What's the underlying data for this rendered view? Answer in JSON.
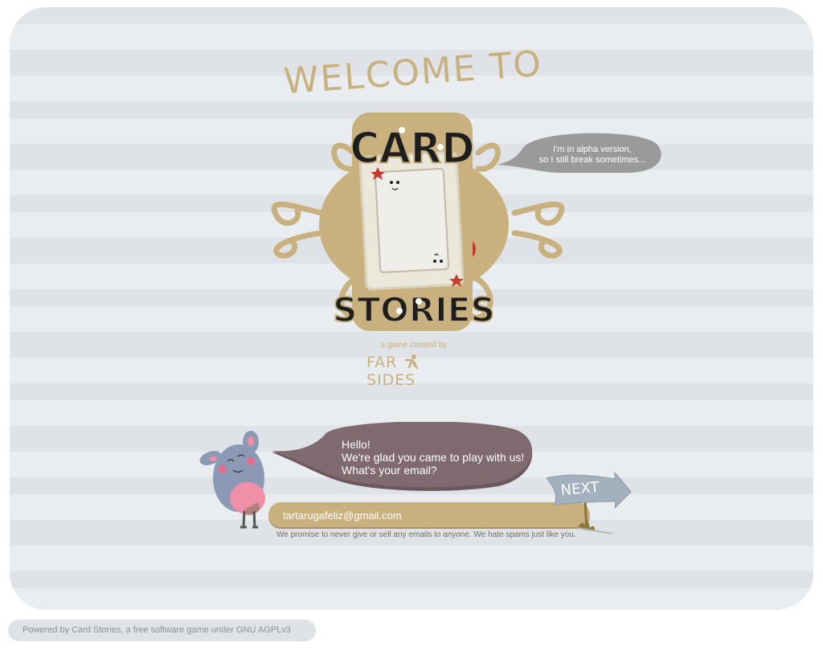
{
  "logo": {
    "welcome_to": "WELCOME TO",
    "card": "CARD",
    "stories": "STORIES"
  },
  "alpha_bubble": {
    "line1": "I'm in alpha version,",
    "line2": "so I still break sometimes..."
  },
  "credit": {
    "created_by": "a game created by",
    "studio_left": "FAR",
    "studio_right": "SIDES"
  },
  "greeting": {
    "line1": "Hello!",
    "line2": "We're glad you came to play with us!",
    "line3": "What's your email?"
  },
  "email_form": {
    "value": "tartarugafeliz@gmail.com",
    "next_label": "NEXT",
    "promise": "We promise to never give or sell any emails to anyone. We hate spams just like you."
  },
  "footer": {
    "text": "Powered by Card Stories, a free software game under GNU AGPLv3"
  },
  "colors": {
    "tan": "#c8b17f",
    "speech_bubble": "#7f6a70",
    "alpha_bubble": "#9a9a9a",
    "card_red": "#c83a2e",
    "mascot_blue": "#8b99b5",
    "mascot_pink": "#ef8fa8"
  }
}
